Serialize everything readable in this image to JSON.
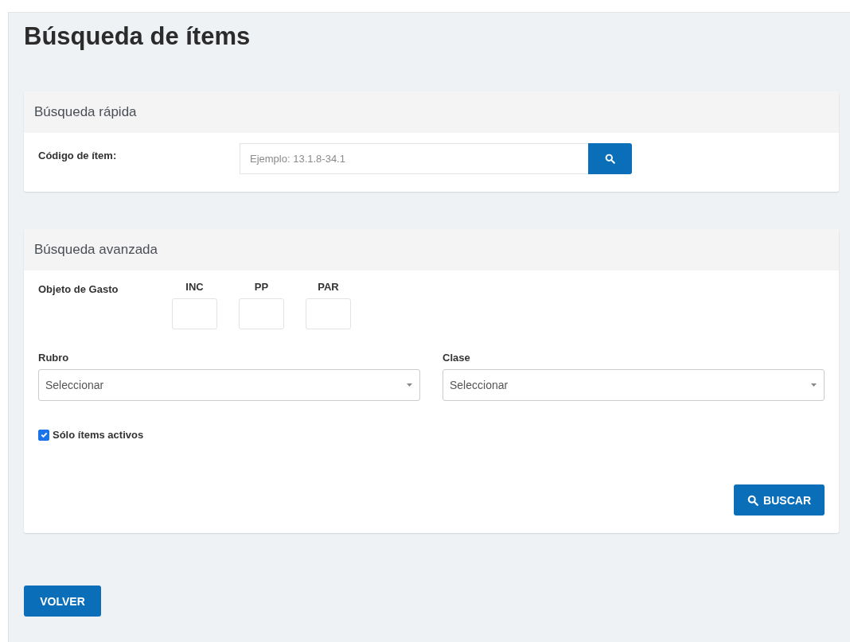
{
  "page": {
    "title": "Búsqueda de ítems"
  },
  "quick_search": {
    "title": "Búsqueda rápida",
    "label": "Código de ítem:",
    "placeholder": "Ejemplo: 13.1.8-34.1"
  },
  "advanced_search": {
    "title": "Búsqueda avanzada",
    "object_label": "Objeto de Gasto",
    "code_fields": [
      {
        "label": "INC"
      },
      {
        "label": "PP"
      },
      {
        "label": "PAR"
      }
    ],
    "selects": [
      {
        "label": "Rubro",
        "value": "Seleccionar"
      },
      {
        "label": "Clase",
        "value": "Seleccionar"
      }
    ],
    "active_only": {
      "label": "Sólo ítems activos",
      "checked": true
    },
    "search_button": "BUSCAR"
  },
  "back_button": "VOLVER"
}
